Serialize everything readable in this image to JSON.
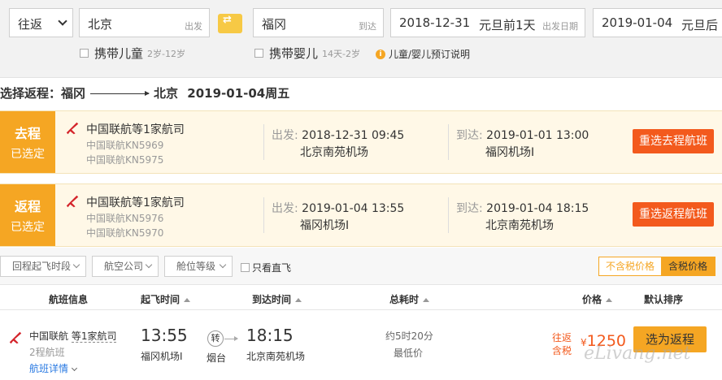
{
  "search": {
    "trip_type": "往返",
    "from_city": "北京",
    "from_tag": "出发",
    "to_city": "福冈",
    "to_tag": "到达",
    "depart_date": "2018-12-31",
    "depart_holiday": "元旦前1天",
    "depart_hint": "出发日期",
    "return_date": "2019-01-04",
    "return_holiday": "元旦后",
    "child_label": "携带儿童",
    "child_sub": "2岁-12岁",
    "infant_label": "携带婴儿",
    "infant_sub": "14天-2岁",
    "booking_note": "儿童/婴儿预订说明"
  },
  "route": {
    "prefix": "选择返程：",
    "from": "福冈",
    "to": "北京",
    "date": "2019-01-04周五"
  },
  "selected": [
    {
      "badge_top": "去程",
      "badge_bottom": "已选定",
      "airline": "中国联航等1家航司",
      "flight1": "中国联航KN5969",
      "flight2": "中国联航KN5975",
      "dep_label": "出发: ",
      "dep_time": "2018-12-31 09:45",
      "dep_airport": "北京南苑机场",
      "arr_label": "到达: ",
      "arr_time": "2019-01-01 13:00",
      "arr_airport": "福冈机场I",
      "button": "重选去程航班"
    },
    {
      "badge_top": "返程",
      "badge_bottom": "已选定",
      "airline": "中国联航等1家航司",
      "flight1": "中国联航KN5976",
      "flight2": "中国联航KN5970",
      "dep_label": "出发: ",
      "dep_time": "2019-01-04 13:55",
      "dep_airport": "福冈机场I",
      "arr_label": "到达: ",
      "arr_time": "2019-01-04 18:15",
      "arr_airport": "北京南苑机场",
      "button": "重选返程航班"
    }
  ],
  "filters": {
    "return_time": "回程起飞时段",
    "airline": "航空公司",
    "cabin": "舱位等级",
    "direct_only": "只看直飞",
    "price_excl_tax": "不含税价格",
    "price_incl_tax": "含税价格"
  },
  "columns": {
    "info": "航班信息",
    "dep": "起飞时间",
    "arr": "到达时间",
    "duration": "总耗时",
    "price": "价格",
    "sort": "默认排序"
  },
  "result": {
    "airline_prefix": "中国联航 ",
    "airline_link": "等1家航司",
    "stops": "2程航班",
    "detail": "航班详情",
    "dep_time": "13:55",
    "dep_airport": "福冈机场I",
    "transfer": "转",
    "transfer_city": "烟台",
    "arr_time": "18:15",
    "arr_airport": "北京南苑机场",
    "duration": "约5时20分",
    "lowest": "最低价",
    "price_label1": "往返",
    "price_label2": "含税",
    "currency": "¥",
    "price": "1250",
    "select": "选为返程"
  },
  "watermark": "eLivang.net",
  "colors": {
    "accent_orange": "#f5a623",
    "button_red": "#f35a1d",
    "link_blue": "#2a7ae2"
  }
}
